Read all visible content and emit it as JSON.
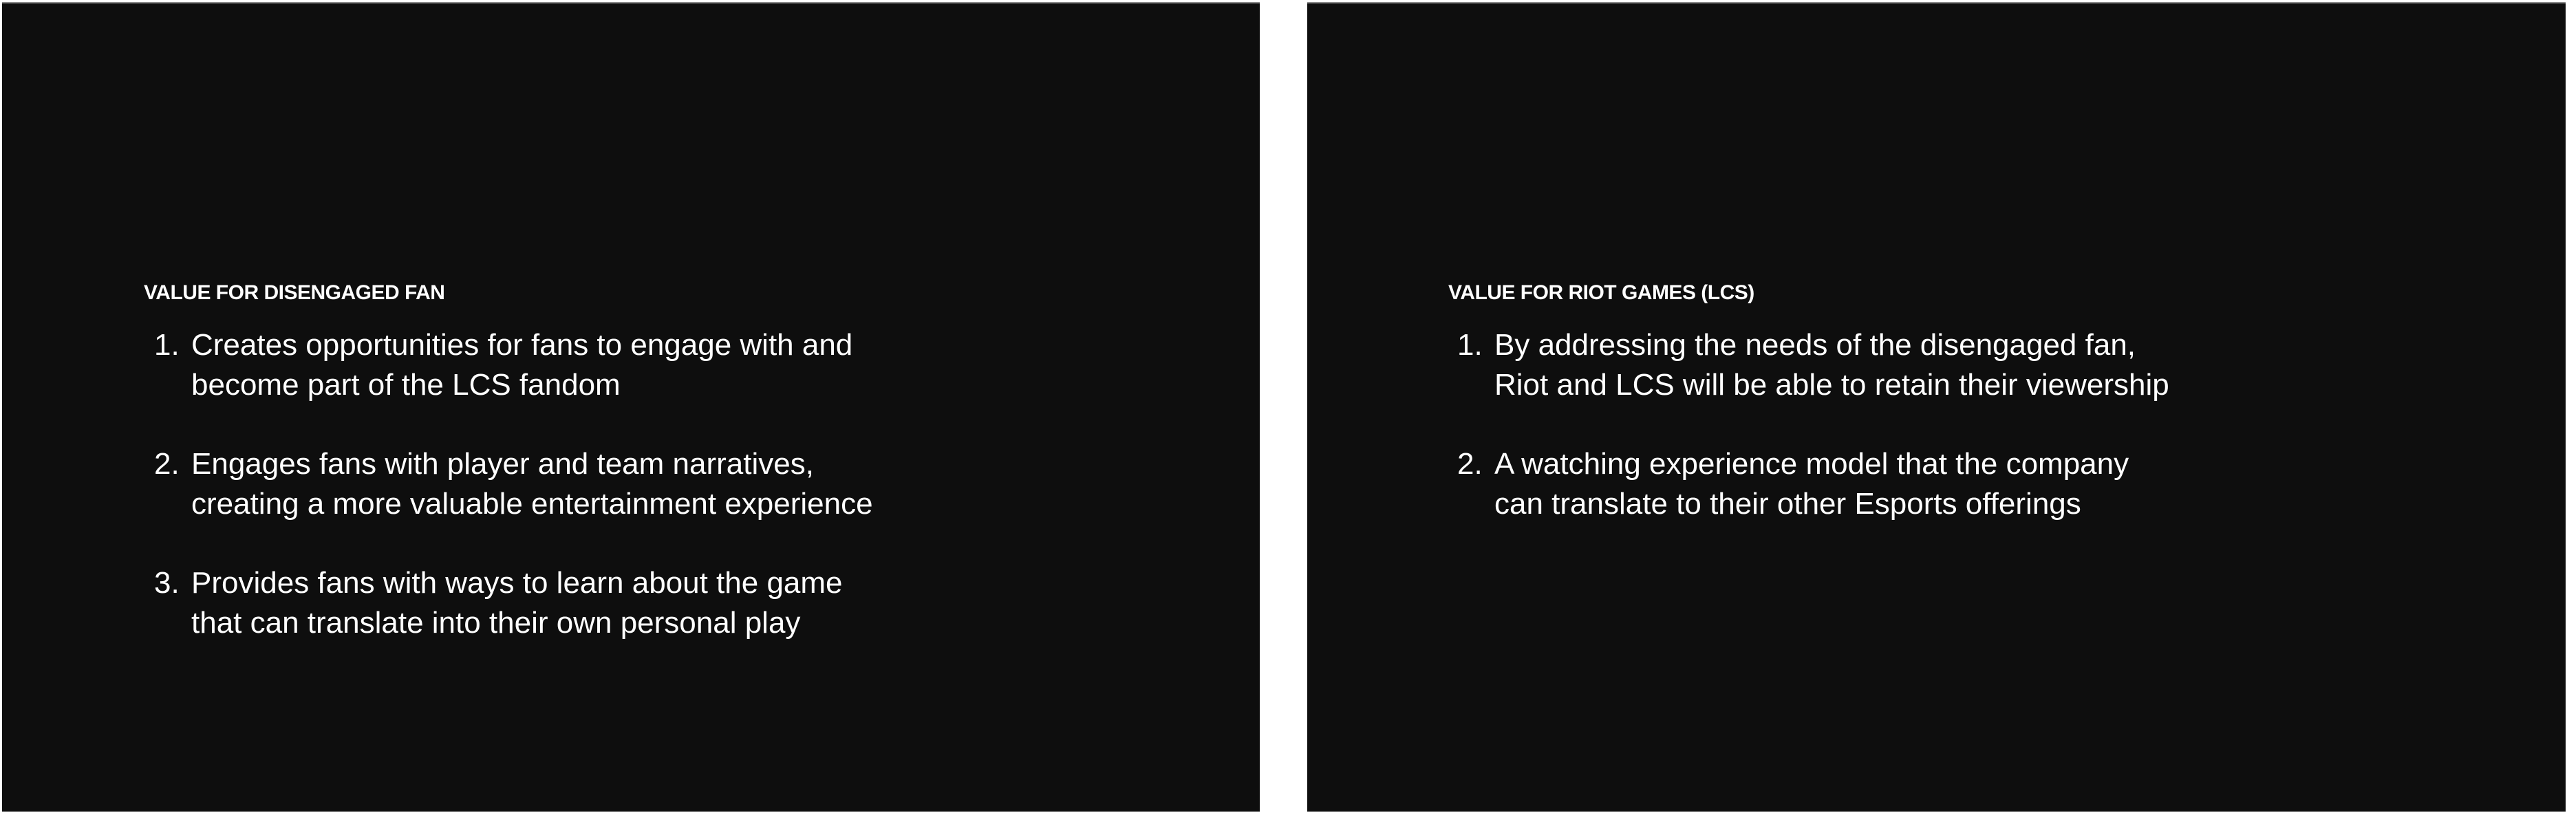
{
  "slides": [
    {
      "heading": "VALUE FOR DISENGAGED FAN",
      "items": [
        {
          "number": "1.",
          "lines": [
            "Creates opportunities for fans to engage with and",
            "become part of the LCS fandom"
          ]
        },
        {
          "number": "2.",
          "lines": [
            "Engages fans with player and team narratives,",
            "creating a more valuable entertainment experience"
          ]
        },
        {
          "number": "3.",
          "lines": [
            "Provides fans with ways to learn about the game",
            "that can translate into their own personal play"
          ]
        }
      ]
    },
    {
      "heading": "VALUE FOR RIOT GAMES (LCS)",
      "items": [
        {
          "number": "1.",
          "lines": [
            "By addressing the needs of the disengaged fan,",
            "Riot and LCS will be able to retain their viewership"
          ]
        },
        {
          "number": "2.",
          "lines": [
            "A watching experience model that the company",
            "can translate to their other Esports offerings"
          ]
        }
      ]
    }
  ]
}
